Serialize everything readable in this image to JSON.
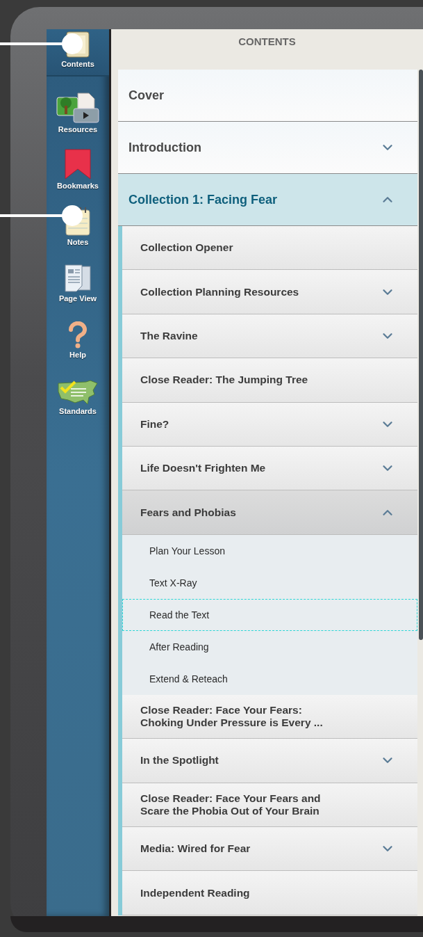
{
  "sidebar": {
    "items": [
      {
        "label": "Contents",
        "selected": true,
        "marked": true
      },
      {
        "label": "Resources",
        "selected": false,
        "marked": false
      },
      {
        "label": "Bookmarks",
        "selected": false,
        "marked": false
      },
      {
        "label": "Notes",
        "selected": false,
        "marked": true
      },
      {
        "label": "Page View",
        "selected": false,
        "marked": false
      },
      {
        "label": "Help",
        "selected": false,
        "marked": false
      },
      {
        "label": "Standards",
        "selected": false,
        "marked": false
      }
    ]
  },
  "contents": {
    "title": "CONTENTS",
    "items": [
      {
        "label": "Cover",
        "kind": "leaf"
      },
      {
        "label": "Introduction",
        "kind": "section",
        "expanded": false
      },
      {
        "label": "Collection 1: Facing Fear",
        "kind": "section",
        "expanded": true,
        "children": [
          {
            "label": "Collection Opener",
            "kind": "leaf",
            "selected": false
          },
          {
            "label": "Collection Planning Resources",
            "kind": "section",
            "expanded": false,
            "selected": false
          },
          {
            "label": "The Ravine",
            "kind": "section",
            "expanded": false,
            "selected": false
          },
          {
            "label": "Close Reader: The Jumping Tree",
            "kind": "leaf",
            "selected": false
          },
          {
            "label": "Fine?",
            "kind": "section",
            "expanded": false,
            "selected": false
          },
          {
            "label": "Life Doesn't Frighten Me",
            "kind": "section",
            "expanded": false,
            "selected": false
          },
          {
            "label": "Fears and Phobias",
            "kind": "section",
            "expanded": true,
            "selected": true,
            "children": [
              {
                "label": "Plan Your Lesson",
                "focused": false
              },
              {
                "label": "Text X-Ray",
                "focused": false
              },
              {
                "label": "Read the Text",
                "focused": true
              },
              {
                "label": "After Reading",
                "focused": false
              },
              {
                "label": "Extend & Reteach",
                "focused": false
              }
            ]
          },
          {
            "label": "Close Reader: Face Your Fears: Choking Under Pressure is Every ...",
            "kind": "leaf",
            "selected": false
          },
          {
            "label": "In the Spotlight",
            "kind": "section",
            "expanded": false,
            "selected": false
          },
          {
            "label": "Close Reader: Face Your Fears and Scare the Phobia Out of Your Brain",
            "kind": "leaf",
            "selected": false
          },
          {
            "label": "Media: Wired for Fear",
            "kind": "section",
            "expanded": false,
            "selected": false
          },
          {
            "label": "Independent Reading",
            "kind": "leaf",
            "selected": false
          }
        ]
      }
    ]
  }
}
